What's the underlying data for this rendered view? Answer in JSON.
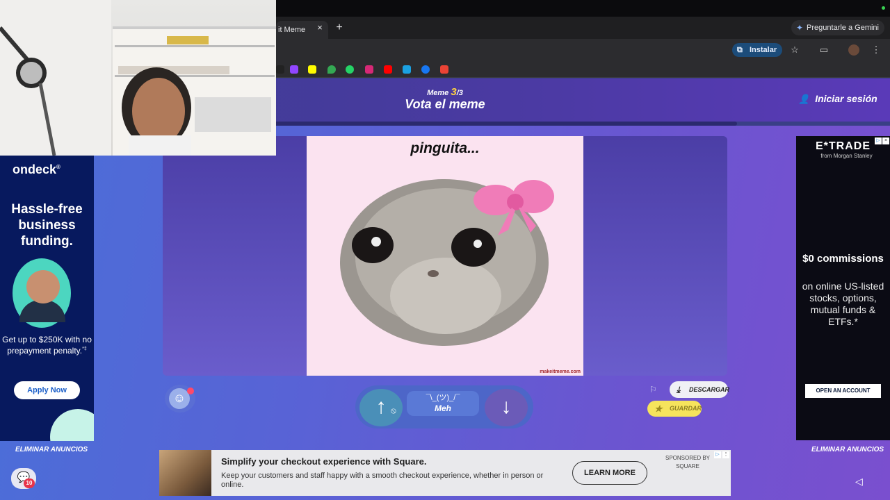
{
  "browser": {
    "tab_title": "it Meme",
    "tab_close": "×",
    "new_tab": "+",
    "gemini_label": "Preguntarle a Gemini",
    "install_label": "Instalar"
  },
  "header": {
    "meme_label": "Meme",
    "meme_index": "3",
    "meme_total": "/3",
    "title": "Vota el meme",
    "login_label": "Iniciar sesión"
  },
  "meme": {
    "caption": "pinguita...",
    "watermark": "makeitmeme.com"
  },
  "vote": {
    "up_icon": "↑",
    "down_icon": "↓",
    "meh_face": "¯\\_(ツ)_/¯",
    "meh_label": "Meh"
  },
  "actions": {
    "download_label": "DESCARGAR",
    "save_label": "GUARDAR"
  },
  "remove_ads_left": "ELIMINAR ANUNCIOS",
  "remove_ads_right": "ELIMINAR ANUNCIOS",
  "ad_left": {
    "brand": "ondeck",
    "brand_mark": "®",
    "headline": "Hassle-free business funding.",
    "body": "Get up to $250K with no prepayment penalty.",
    "body_mark": "*‡",
    "cta": "Apply Now"
  },
  "ad_right": {
    "brand": "E*TRADE",
    "sub_brand": "from Morgan Stanley",
    "headline": "$0 commissions",
    "body": "on online US-listed stocks, options, mutual funds & ETFs.*",
    "cta": "OPEN AN ACCOUNT"
  },
  "ad_bottom": {
    "title": "Simplify your checkout experience with Square.",
    "description": "Keep your customers and staff happy with a smooth checkout experience, whether in person or online.",
    "cta": "LEARN MORE",
    "sponsor_line1": "SPONSORED BY",
    "sponsor_line2": "SQUARE"
  },
  "chat_badge": "10",
  "colors": {
    "accent_yellow": "#f6e45c",
    "upvote": "#4a8fb8",
    "downvote": "#6b5bb8",
    "brand_purple": "#4b3aa3"
  }
}
